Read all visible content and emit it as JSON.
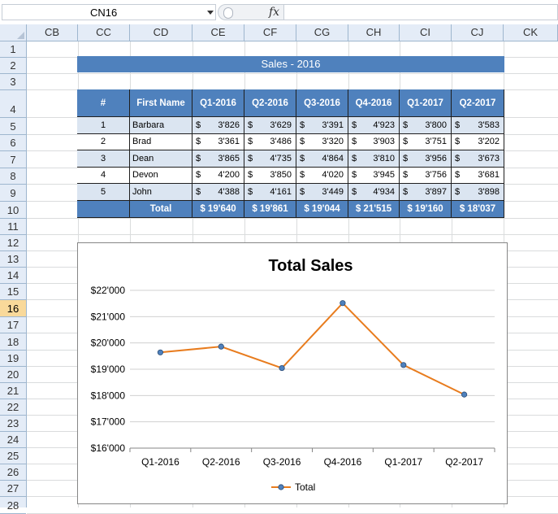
{
  "formula_bar": {
    "name_box": "CN16",
    "fx_label": "fx",
    "formula": ""
  },
  "columns": [
    "CB",
    "CC",
    "CD",
    "CE",
    "CF",
    "CG",
    "CH",
    "CI",
    "CJ",
    "CK"
  ],
  "rows": [
    "1",
    "2",
    "3",
    "4",
    "5",
    "6",
    "7",
    "8",
    "9",
    "10",
    "11",
    "12",
    "13",
    "14",
    "15",
    "16",
    "17",
    "18",
    "19",
    "20",
    "21",
    "22",
    "23",
    "24",
    "25",
    "26",
    "27",
    "28"
  ],
  "active_row": "16",
  "sheet": {
    "banner_title": "Sales - 2016",
    "table": {
      "headers": [
        "#",
        "First Name",
        "Q1-2016",
        "Q2-2016",
        "Q3-2016",
        "Q4-2016",
        "Q1-2017",
        "Q2-2017"
      ],
      "currency_symbol": "$",
      "rows": [
        {
          "num": "1",
          "name": "Barbara",
          "values": [
            "3'826",
            "3'629",
            "3'391",
            "4'923",
            "3'800",
            "3'583"
          ]
        },
        {
          "num": "2",
          "name": "Brad",
          "values": [
            "3'361",
            "3'486",
            "3'320",
            "3'903",
            "3'751",
            "3'202"
          ]
        },
        {
          "num": "3",
          "name": "Dean",
          "values": [
            "3'865",
            "4'735",
            "4'864",
            "3'810",
            "3'956",
            "3'673"
          ]
        },
        {
          "num": "4",
          "name": "Devon",
          "values": [
            "4'200",
            "3'850",
            "4'020",
            "3'945",
            "3'756",
            "3'681"
          ]
        },
        {
          "num": "5",
          "name": "John",
          "values": [
            "4'388",
            "4'161",
            "3'449",
            "4'934",
            "3'897",
            "3'898"
          ]
        }
      ],
      "total_label": "Total",
      "totals": [
        "$ 19'640",
        "$ 19'861",
        "$ 19'044",
        "$ 21'515",
        "$ 19'160",
        "$ 18'037"
      ]
    }
  },
  "chart_data": {
    "type": "line",
    "title": "Total Sales",
    "categories": [
      "Q1-2016",
      "Q2-2016",
      "Q3-2016",
      "Q4-2016",
      "Q1-2017",
      "Q2-2017"
    ],
    "series": [
      {
        "name": "Total",
        "values": [
          19640,
          19861,
          19044,
          21515,
          19160,
          18037
        ],
        "color": "#e87c1e"
      }
    ],
    "ylim": [
      16000,
      22000
    ],
    "y_ticks": [
      "$16'000",
      "$17'000",
      "$18'000",
      "$19'000",
      "$20'000",
      "$21'000",
      "$22'000"
    ],
    "grid": true,
    "legend": "bottom",
    "marker_color": "#4f81bd"
  },
  "colors": {
    "header_blue": "#4f81bd",
    "row_band": "#dbe5f1",
    "active_row": "#f9d99a"
  }
}
